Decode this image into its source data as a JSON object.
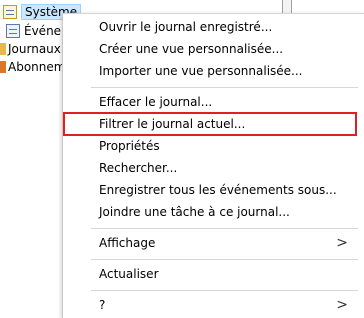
{
  "tree": {
    "items": [
      {
        "label": "Système",
        "icon": "log-icon",
        "selected": true
      },
      {
        "label": "Événements",
        "icon": "log-icon"
      },
      {
        "label": "Journaux des applications",
        "icon": "folder-icon"
      },
      {
        "label": "Abonnements",
        "icon": "folder-icon"
      }
    ]
  },
  "menu": {
    "items": [
      {
        "label": "Ouvrir le journal enregistré..."
      },
      {
        "label": "Créer une vue personnalisée..."
      },
      {
        "label": "Importer une vue personnalisée..."
      },
      {
        "label": "Effacer le journal..."
      },
      {
        "label": "Filtrer le journal actuel...",
        "highlighted": true
      },
      {
        "label": "Propriétés"
      },
      {
        "label": "Rechercher..."
      },
      {
        "label": "Enregistrer tous les événements sous..."
      },
      {
        "label": "Joindre une tâche à ce journal..."
      },
      {
        "label": "Affichage",
        "submenu": true
      },
      {
        "label": "Actualiser"
      },
      {
        "label": "?",
        "submenu": true
      }
    ],
    "submenu_arrow": ">",
    "highlight_color": "#e02020"
  }
}
